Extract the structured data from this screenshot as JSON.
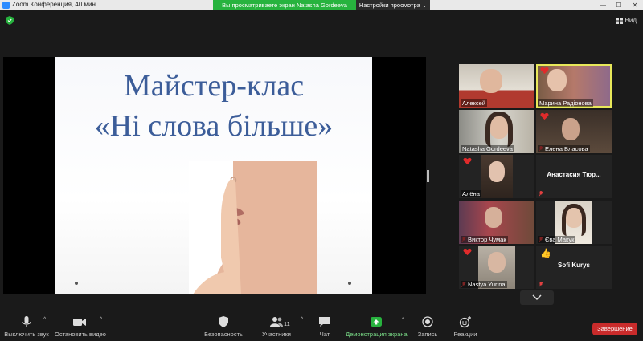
{
  "window": {
    "title": "Zoom Конференция, 40 мин",
    "minimize": "—",
    "maximize": "☐",
    "close": "✕"
  },
  "banner": {
    "viewing_text": "Вы просматриваете экран Natasha Gordeeva",
    "view_options": "Настройки просмотра ⌄"
  },
  "gallery_toggle": "Вид",
  "slide": {
    "title_line1": "Майстер-клас",
    "title_line2": "«Ні слова більше»"
  },
  "participants": [
    {
      "name": "Алексей",
      "muted": false,
      "reaction": ""
    },
    {
      "name": "Марина Радіонова",
      "muted": false,
      "reaction": "heart",
      "active": true
    },
    {
      "name": "Natasha Gordeeva",
      "muted": false,
      "reaction": ""
    },
    {
      "name": "Елена Власова",
      "muted": true,
      "reaction": "heart"
    },
    {
      "name": "Алёна",
      "muted": true,
      "reaction": "heart"
    },
    {
      "name": "Анастасия Тюр...",
      "muted": true,
      "reaction": "",
      "video_off": true
    },
    {
      "name": "Виктор Чумак",
      "muted": true,
      "reaction": ""
    },
    {
      "name": "Єва Макук",
      "muted": true,
      "reaction": ""
    },
    {
      "name": "Nastya Yurina",
      "muted": true,
      "reaction": "heart"
    },
    {
      "name": "Sofi Kurys",
      "muted": true,
      "reaction": "thumbs-up",
      "video_off": true
    }
  ],
  "toolbar": {
    "mute": "Выключить звук",
    "stop_video": "Остановить видео",
    "security": "Безопасность",
    "participants": "Участники",
    "participants_count": "11",
    "chat": "Чат",
    "share_screen": "Демонстрация экрана",
    "record": "Запись",
    "reactions": "Реакции",
    "end": "Завершение"
  },
  "colors": {
    "share_green": "#27b33e",
    "end_red": "#c92b2b",
    "active_speaker": "#e8e85a",
    "slide_title": "#3c5d99"
  }
}
